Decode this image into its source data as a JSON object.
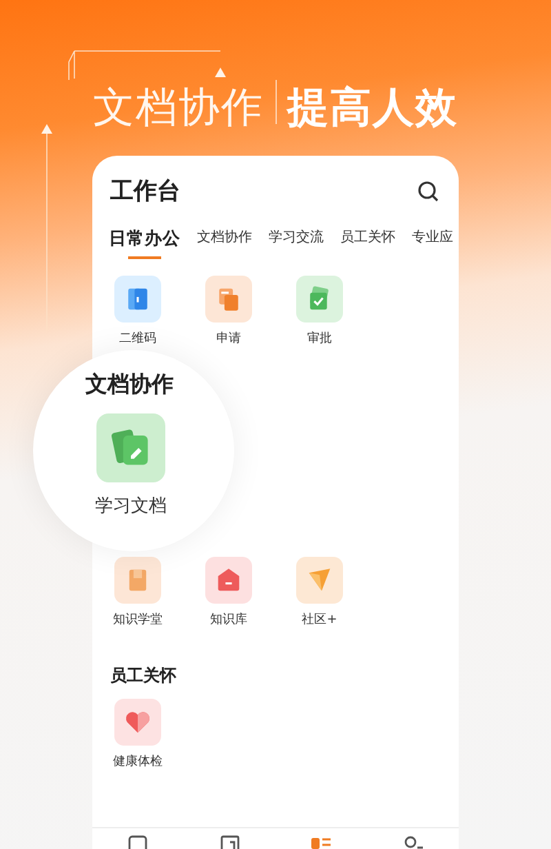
{
  "headline": {
    "lead": "文档协作",
    "emphasis": "提高人效"
  },
  "card": {
    "title": "工作台",
    "tabs": [
      {
        "label": "日常办公",
        "selected": true
      },
      {
        "label": "文档协作",
        "selected": false
      },
      {
        "label": "学习交流",
        "selected": false
      },
      {
        "label": "员工关怀",
        "selected": false
      },
      {
        "label": "专业应",
        "selected": false
      }
    ],
    "sections": [
      {
        "items": [
          {
            "label": "二维码",
            "kind": "qrcode"
          },
          {
            "label": "申请",
            "kind": "apply"
          },
          {
            "label": "审批",
            "kind": "approve"
          }
        ]
      },
      {
        "items": [
          {
            "label": "知识学堂",
            "kind": "school"
          },
          {
            "label": "知识库",
            "kind": "library"
          },
          {
            "label": "社区+",
            "kind": "community"
          }
        ]
      },
      {
        "title": "员工关怀",
        "items": [
          {
            "label": "健康体检",
            "kind": "health"
          }
        ]
      }
    ],
    "bottom_nav": [
      {
        "selected": false
      },
      {
        "selected": false
      },
      {
        "selected": true
      },
      {
        "selected": false
      }
    ]
  },
  "callout": {
    "title": "文档协作",
    "item": {
      "label": "学习文档",
      "kind": "doc"
    }
  }
}
